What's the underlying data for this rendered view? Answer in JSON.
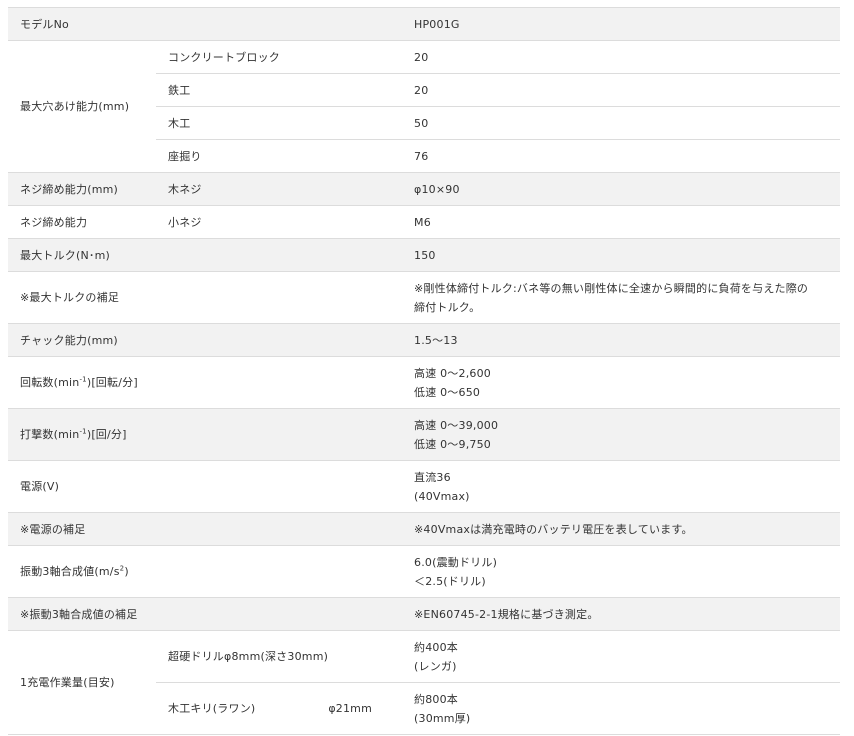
{
  "model_row": {
    "label": "モデルNo",
    "value": "HP001G"
  },
  "drilling": {
    "label": "最大穴あけ能力(mm)",
    "items": [
      {
        "sub": "コンクリートブロック",
        "value": "20"
      },
      {
        "sub": "鉄工",
        "value": "20"
      },
      {
        "sub": "木工",
        "value": "50"
      },
      {
        "sub": "座掘り",
        "value": "76"
      }
    ]
  },
  "screw_mm": {
    "label": "ネジ締め能力(mm)",
    "sub": "木ネジ",
    "value": "φ10×90"
  },
  "screw": {
    "label": "ネジ締め能力",
    "sub": "小ネジ",
    "value": "M6"
  },
  "torque": {
    "label": "最大トルク(N･m)",
    "value": "150"
  },
  "torque_note": {
    "label": "※最大トルクの補足",
    "value_1": "※剛性体締付トルク:バネ等の無い剛性体に全速から瞬間的に負荷を与えた際の",
    "value_2": "締付トルク。"
  },
  "chuck": {
    "label": "チャック能力(mm)",
    "value": "1.5～13"
  },
  "rpm": {
    "label_a": "回転数(min",
    "label_sup": "-1",
    "label_b": ")[回転/分]",
    "value_1": "高速 0～2,600",
    "value_2": "低速 0～650"
  },
  "bpm": {
    "label_a": "打撃数(min",
    "label_sup": "-1",
    "label_b": ")[回/分]",
    "value_1": "高速 0～39,000",
    "value_2": "低速 0～9,750"
  },
  "power": {
    "label": "電源(V)",
    "value_1": "直流36",
    "value_2": "(40Vmax)"
  },
  "power_note": {
    "label": "※電源の補足",
    "value": "※40Vmaxは満充電時のバッテリ電圧を表しています。"
  },
  "vibration": {
    "label_a": "振動3軸合成値(m/s",
    "label_sup": "2",
    "label_b": ")",
    "value_1": "6.0(震動ドリル)",
    "value_2": "＜2.5(ドリル)"
  },
  "vibration_note": {
    "label": "※振動3軸合成値の補足",
    "value": "※EN60745-2-1規格に基づき測定。"
  },
  "work": {
    "label": "1充電作業量(目安)",
    "items": [
      {
        "sub": "超硬ドリルφ8mm(深さ30mm)",
        "sub_extra": "",
        "value_1": "約400本",
        "value_2": "(レンガ)"
      },
      {
        "sub": "木工キリ(ラワン)",
        "sub_extra": "φ21mm",
        "value_1": "約800本",
        "value_2": "(30mm厚)"
      }
    ]
  }
}
